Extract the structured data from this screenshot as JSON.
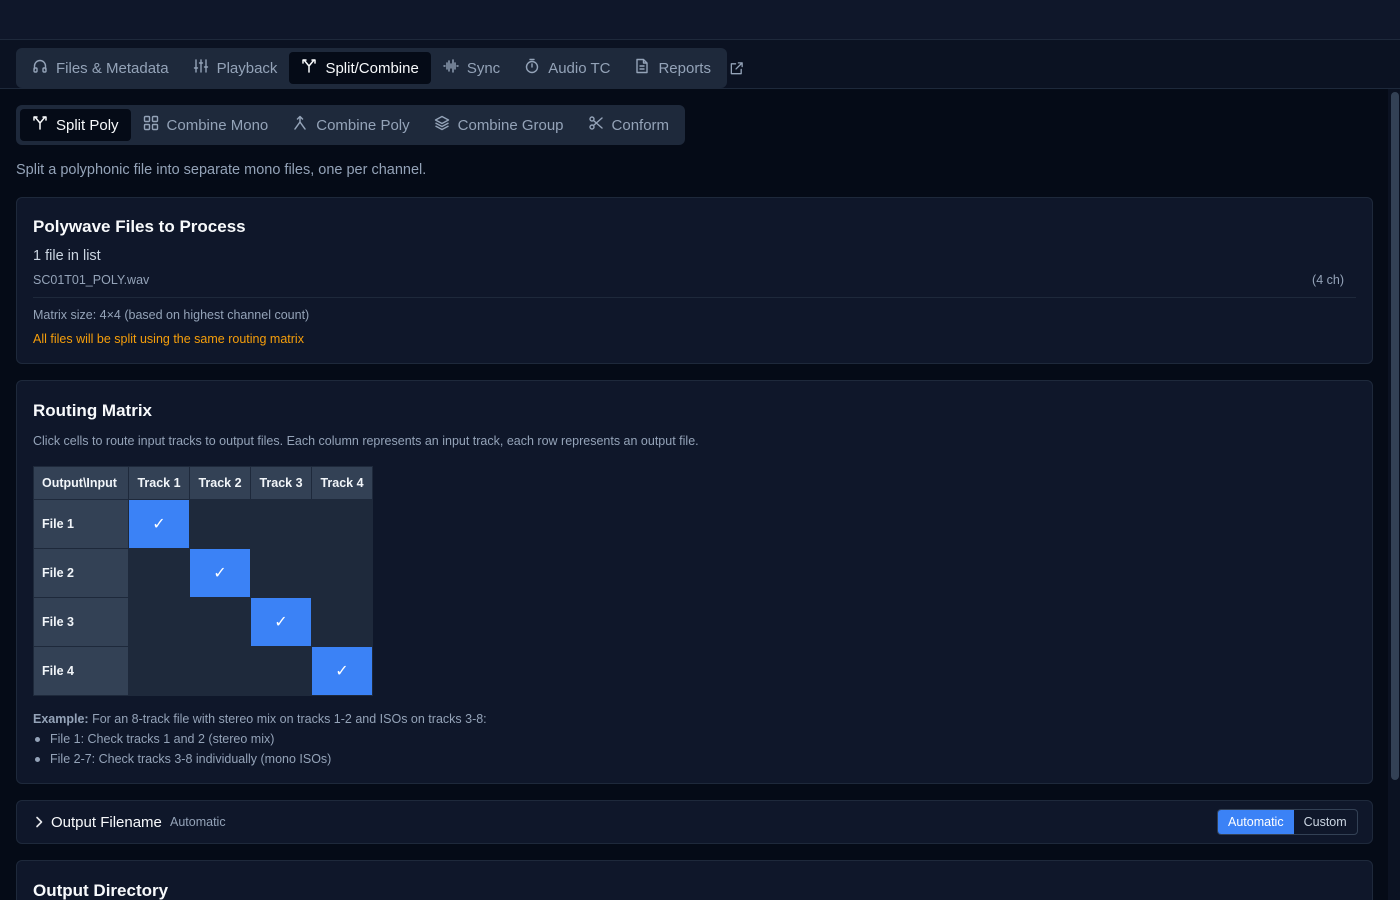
{
  "main_tabs": [
    {
      "label": "Files & Metadata",
      "icon": "headphones-icon",
      "active": false
    },
    {
      "label": "Playback",
      "icon": "sliders-icon",
      "active": false
    },
    {
      "label": "Split/Combine",
      "icon": "split-icon",
      "active": true
    },
    {
      "label": "Sync",
      "icon": "waveform-icon",
      "active": false
    },
    {
      "label": "Audio TC",
      "icon": "timer-icon",
      "active": false
    },
    {
      "label": "Reports",
      "icon": "document-icon",
      "active": false
    }
  ],
  "sub_tabs": [
    {
      "label": "Split Poly",
      "icon": "split-icon",
      "active": true
    },
    {
      "label": "Combine Mono",
      "icon": "grid-icon",
      "active": false
    },
    {
      "label": "Combine Poly",
      "icon": "merge-icon",
      "active": false
    },
    {
      "label": "Combine Group",
      "icon": "layers-icon",
      "active": false
    },
    {
      "label": "Conform",
      "icon": "scissors-icon",
      "active": false
    }
  ],
  "description": "Split a polyphonic file into separate mono files, one per channel.",
  "files_card": {
    "title": "Polywave Files to Process",
    "count": "1 file in list",
    "files": [
      {
        "name": "SC01T01_POLY.wav",
        "channels": "(4 ch)"
      }
    ],
    "matrix_size": "Matrix size: 4×4 (based on highest channel count)",
    "warning": "All files will be split using the same routing matrix",
    "warning_color": "#f59e0b"
  },
  "routing": {
    "title": "Routing Matrix",
    "description": "Click cells to route input tracks to output files. Each column represents an input track, each row represents an output file.",
    "corner": "Output\\Input",
    "columns": [
      "Track 1",
      "Track 2",
      "Track 3",
      "Track 4"
    ],
    "rows": [
      {
        "label": "File 1",
        "cells": [
          true,
          false,
          false,
          false
        ]
      },
      {
        "label": "File 2",
        "cells": [
          false,
          true,
          false,
          false
        ]
      },
      {
        "label": "File 3",
        "cells": [
          false,
          false,
          true,
          false
        ]
      },
      {
        "label": "File 4",
        "cells": [
          false,
          false,
          false,
          true
        ]
      }
    ],
    "check_glyph": "✓",
    "active_color": "#3b82f6",
    "example_label": "Example:",
    "example_text": " For an 8-track file with stereo mix on tracks 1-2 and ISOs on tracks 3-8:",
    "example_items": [
      "File 1: Check tracks 1 and 2 (stereo mix)",
      "File 2-7: Check tracks 3-8 individually (mono ISOs)"
    ]
  },
  "output_filename": {
    "title": "Output Filename",
    "mode": "Automatic",
    "options": [
      {
        "label": "Automatic",
        "active": true
      },
      {
        "label": "Custom",
        "active": false
      }
    ]
  },
  "output_directory": {
    "title": "Output Directory"
  }
}
